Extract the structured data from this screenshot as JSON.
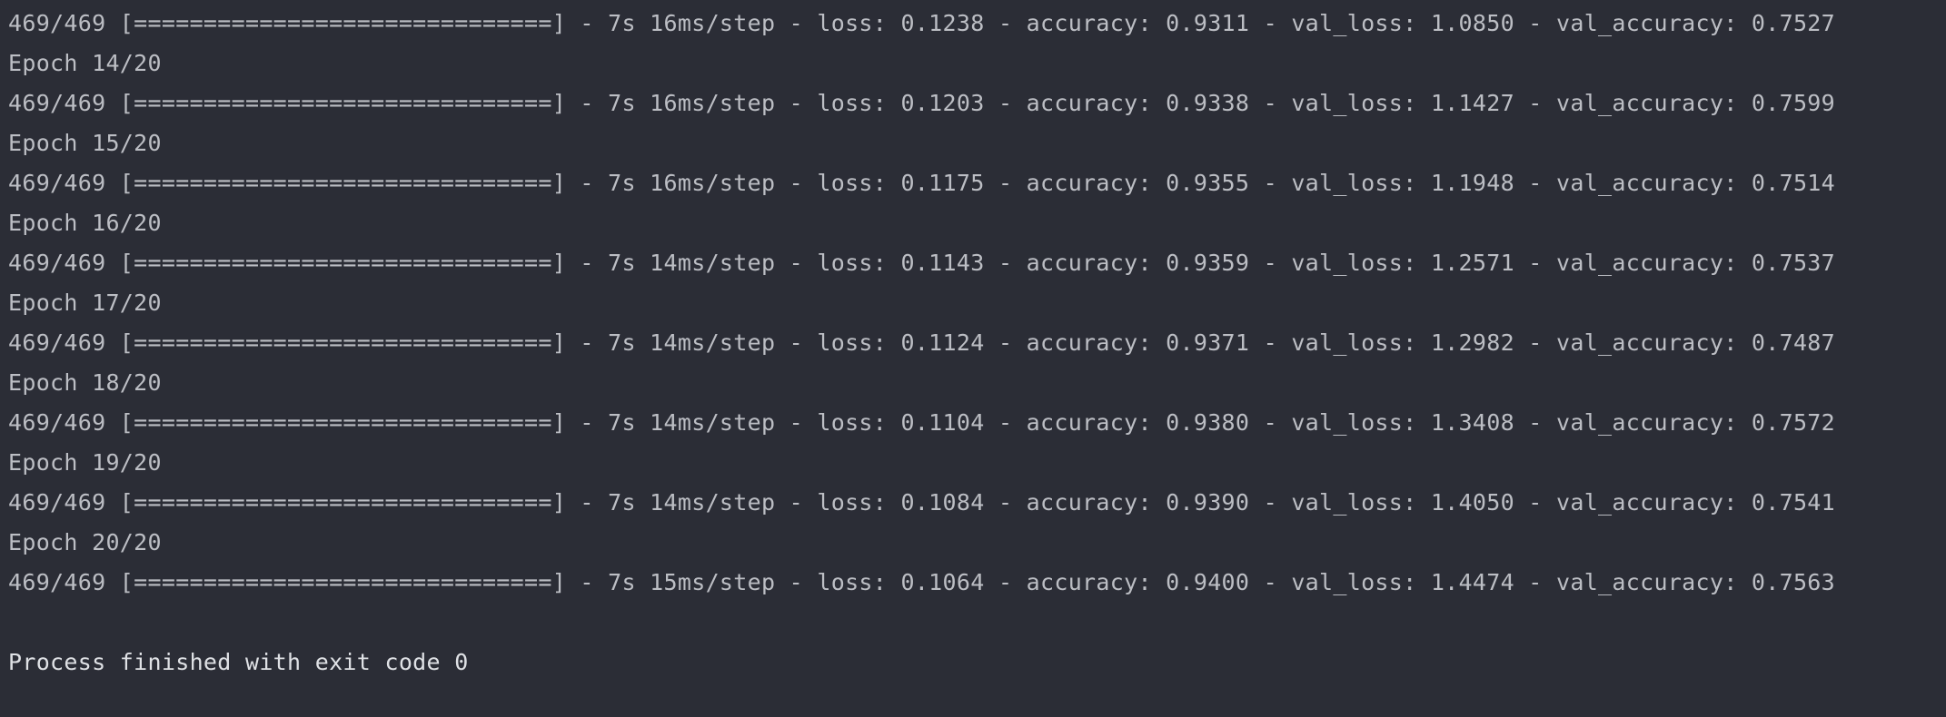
{
  "console": {
    "lines": [
      "469/469 [==============================] - 7s 16ms/step - loss: 0.1238 - accuracy: 0.9311 - val_loss: 1.0850 - val_accuracy: 0.7527",
      "Epoch 14/20",
      "469/469 [==============================] - 7s 16ms/step - loss: 0.1203 - accuracy: 0.9338 - val_loss: 1.1427 - val_accuracy: 0.7599",
      "Epoch 15/20",
      "469/469 [==============================] - 7s 16ms/step - loss: 0.1175 - accuracy: 0.9355 - val_loss: 1.1948 - val_accuracy: 0.7514",
      "Epoch 16/20",
      "469/469 [==============================] - 7s 14ms/step - loss: 0.1143 - accuracy: 0.9359 - val_loss: 1.2571 - val_accuracy: 0.7537",
      "Epoch 17/20",
      "469/469 [==============================] - 7s 14ms/step - loss: 0.1124 - accuracy: 0.9371 - val_loss: 1.2982 - val_accuracy: 0.7487",
      "Epoch 18/20",
      "469/469 [==============================] - 7s 14ms/step - loss: 0.1104 - accuracy: 0.9380 - val_loss: 1.3408 - val_accuracy: 0.7572",
      "Epoch 19/20",
      "469/469 [==============================] - 7s 14ms/step - loss: 0.1084 - accuracy: 0.9390 - val_loss: 1.4050 - val_accuracy: 0.7541",
      "Epoch 20/20",
      "469/469 [==============================] - 7s 15ms/step - loss: 0.1064 - accuracy: 0.9400 - val_loss: 1.4474 - val_accuracy: 0.7563",
      "",
      "Process finished with exit code 0"
    ]
  },
  "colors": {
    "background": "#2b2d36",
    "text": "#bcbec4",
    "final_text": "#dfe1e5"
  }
}
